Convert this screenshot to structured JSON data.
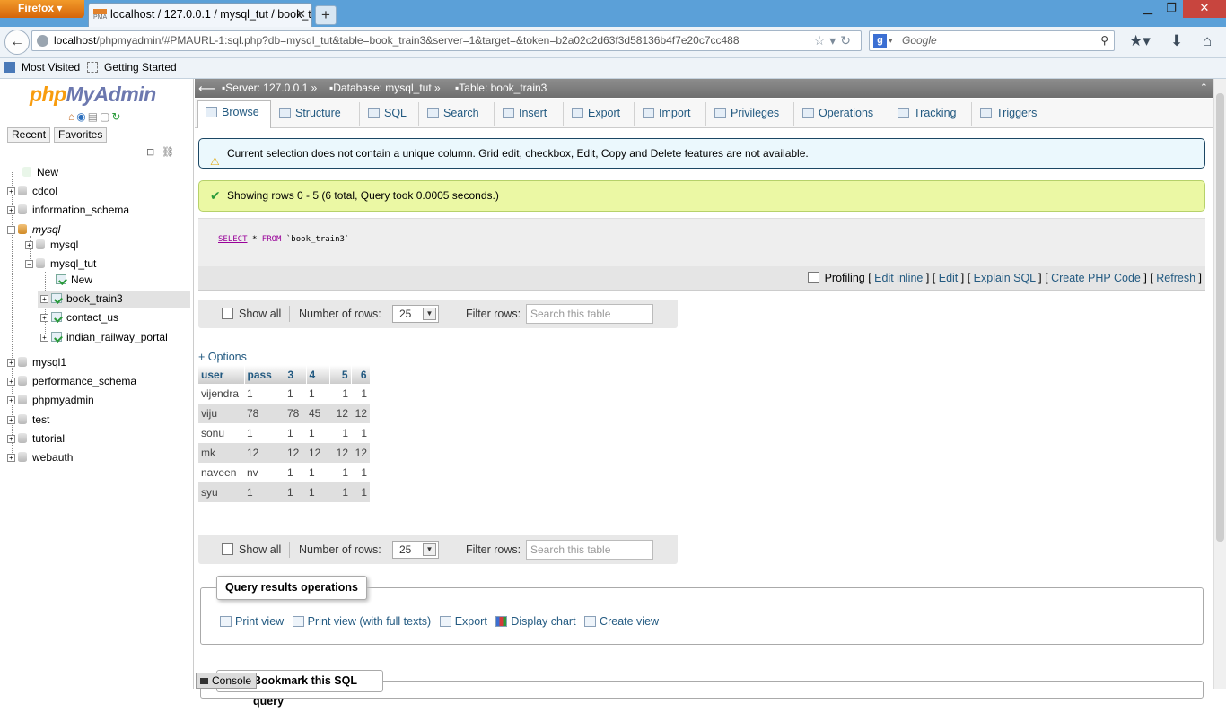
{
  "browser": {
    "menu_label": "Firefox",
    "tab_title": "localhost / 127.0.0.1 / mysql_tut / book_t...",
    "tab_favicon": "PMA",
    "url_host": "localhost",
    "url_rest": "/phpmyadmin/#PMAURL-1:sql.php?db=mysql_tut&table=book_train3&server=1&target=&token=b2a02c2d63f3d58136b4f7e20c7cc488",
    "search_placeholder": "Google",
    "bookmarks": [
      "Most Visited",
      "Getting Started"
    ]
  },
  "pma": {
    "logo_php": "php",
    "logo_myadmin": "MyAdmin",
    "recent_label": "Recent",
    "favorites_label": "Favorites",
    "tree": {
      "new": "New",
      "databases": [
        "cdcol",
        "information_schema",
        "mysql",
        "mysql1",
        "performance_schema",
        "phpmyadmin",
        "test",
        "tutorial",
        "webauth"
      ],
      "mysql_children": [
        "mysql",
        "mysql_tut"
      ],
      "mysql_tut_children": [
        "New",
        "book_train3",
        "contact_us",
        "indian_railway_portal"
      ]
    },
    "breadcrumb": {
      "server": "Server: 127.0.0.1",
      "database": "Database: mysql_tut",
      "table": "Table: book_train3",
      "sep": "»"
    },
    "tabs": [
      "Browse",
      "Structure",
      "SQL",
      "Search",
      "Insert",
      "Export",
      "Import",
      "Privileges",
      "Operations",
      "Tracking",
      "Triggers"
    ],
    "active_tab": "Browse",
    "warning": "Current selection does not contain a unique column. Grid edit, checkbox, Edit, Copy and Delete features are not available.",
    "success": "Showing rows 0 - 5 (6 total, Query took 0.0005 seconds.)",
    "sql": {
      "select": "SELECT",
      "star": "*",
      "from": "FROM",
      "table": "`book_train3`"
    },
    "sql_links": {
      "profiling": "Profiling",
      "edit_inline": "Edit inline",
      "edit": "Edit",
      "explain": "Explain SQL",
      "php": "Create PHP Code",
      "refresh": "Refresh"
    },
    "navbar": {
      "show_all": "Show all",
      "rows_label": "Number of rows:",
      "rows_value": "25",
      "filter_label": "Filter rows:",
      "filter_placeholder": "Search this table"
    },
    "options_label": "+ Options",
    "table": {
      "headers": [
        "user",
        "pass",
        "3",
        "4",
        "5",
        "6"
      ],
      "rows": [
        [
          "vijendra",
          "1",
          "1",
          "1",
          "1",
          "1"
        ],
        [
          "viju",
          "78",
          "78",
          "45",
          "12",
          "12"
        ],
        [
          "sonu",
          "1",
          "1",
          "1",
          "1",
          "1"
        ],
        [
          "mk",
          "12",
          "12",
          "12",
          "12",
          "12"
        ],
        [
          "naveen",
          "nv",
          "1",
          "1",
          "1",
          "1"
        ],
        [
          "syu",
          "1",
          "1",
          "1",
          "1",
          "1"
        ]
      ]
    },
    "query_ops": {
      "legend": "Query results operations",
      "links": [
        "Print view",
        "Print view (with full texts)",
        "Export",
        "Display chart",
        "Create view"
      ]
    },
    "bookmark_legend": "Bookmark this SQL query",
    "console": "Console"
  }
}
